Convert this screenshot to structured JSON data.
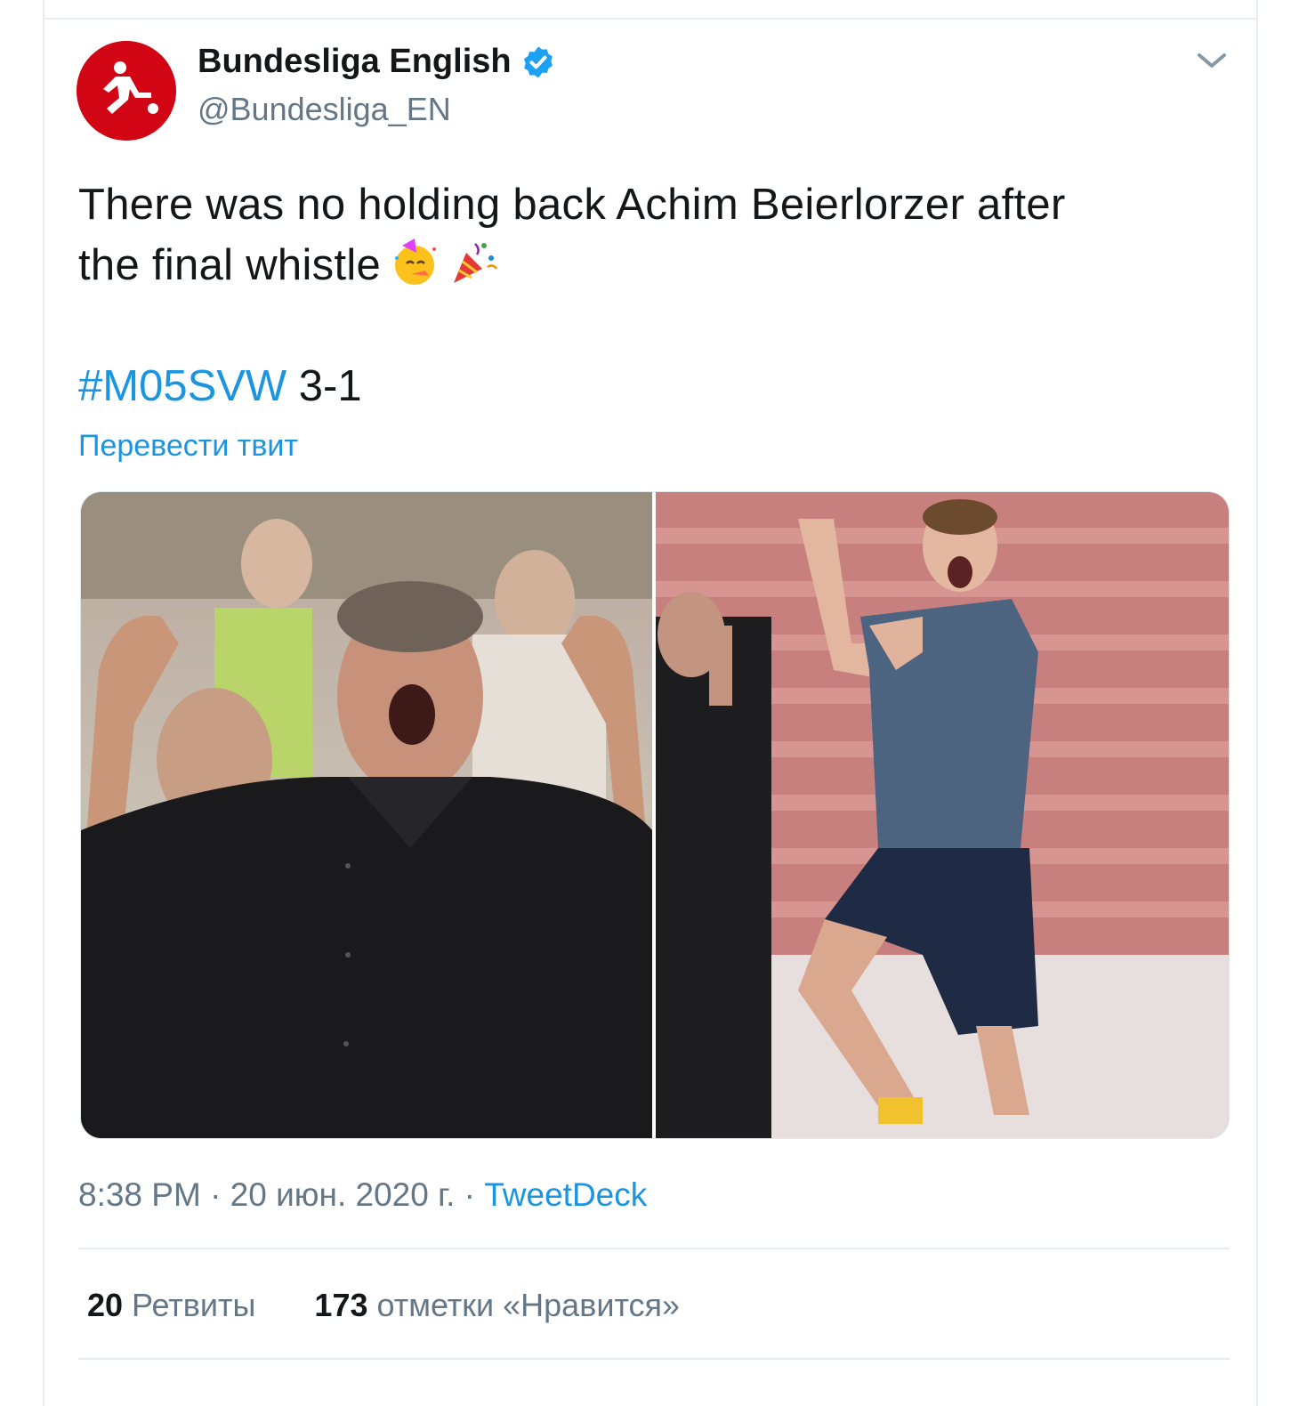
{
  "tweet": {
    "author_name": "Bundesliga English",
    "author_handle": "@Bundesliga_EN",
    "text_line1": "There was no holding back Achim Beierlorzer after",
    "text_line2": "the final whistle",
    "hashtag": "#M05SVW",
    "score": " 3-1",
    "translate_label": "Перевести твит",
    "time": "8:38 PM · 20 июн. 2020 г. · ",
    "source": "TweetDeck",
    "retweets_count": "20",
    "retweets_label": "Ретвиты",
    "likes_count": "173",
    "likes_label": "отметки «Нравится»"
  },
  "icons": {
    "avatar": "bundesliga-logo",
    "verified": "verified-badge-icon",
    "menu": "chevron-down-icon",
    "emoji1": "partying-face-emoji",
    "emoji2": "party-popper-emoji"
  },
  "colors": {
    "link": "#1b95e0",
    "brand_red": "#d20515",
    "muted": "#657786"
  }
}
